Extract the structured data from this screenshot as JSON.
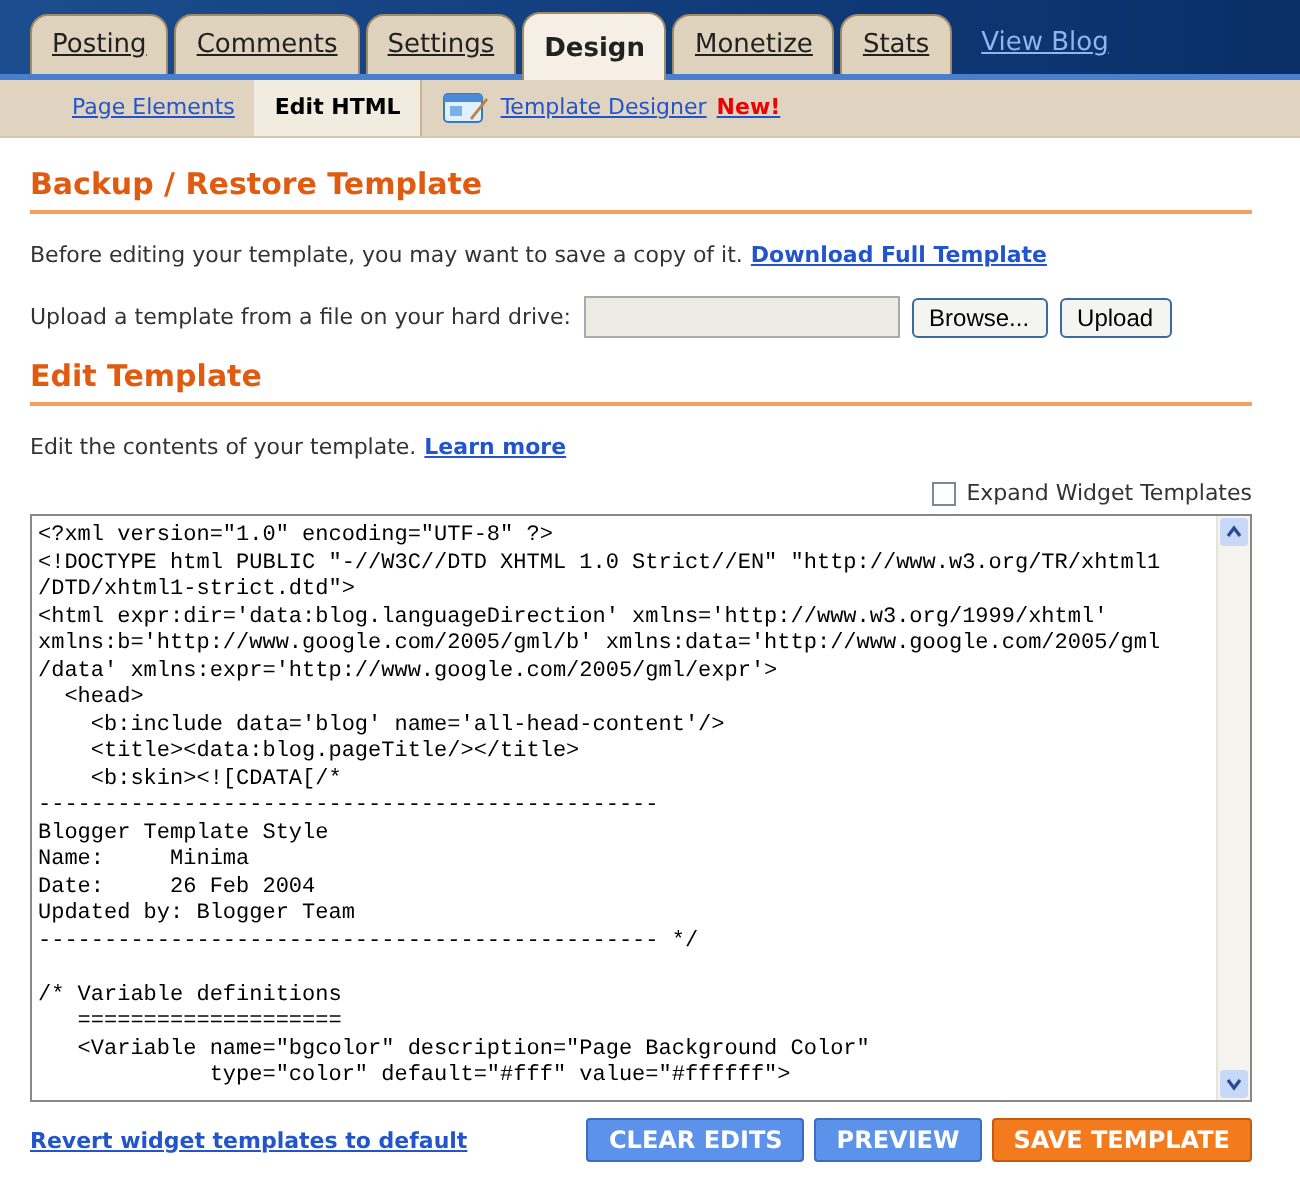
{
  "tabs": [
    {
      "label": "Posting",
      "selected": false
    },
    {
      "label": "Comments",
      "selected": false
    },
    {
      "label": "Settings",
      "selected": false
    },
    {
      "label": "Design",
      "selected": true
    },
    {
      "label": "Monetize",
      "selected": false
    },
    {
      "label": "Stats",
      "selected": false
    }
  ],
  "view_blog_link": "View Blog",
  "subnav": [
    {
      "label": "Page Elements",
      "selected": false
    },
    {
      "label": "Edit HTML",
      "selected": true
    },
    {
      "label": "Template Designer",
      "selected": false,
      "badge": "New!"
    }
  ],
  "backup": {
    "heading": "Backup / Restore Template",
    "intro": "Before editing your template, you may want to save a copy of it.",
    "download_link": "Download Full Template",
    "upload_label": "Upload a template from a file on your hard drive:",
    "browse_button": "Browse...",
    "upload_button": "Upload"
  },
  "edit": {
    "heading": "Edit Template",
    "intro": "Edit the contents of your template.",
    "learn_link": "Learn more",
    "expand_label": "Expand Widget Templates",
    "expand_checked": false,
    "code": "<?xml version=\"1.0\" encoding=\"UTF-8\" ?>\n<!DOCTYPE html PUBLIC \"-//W3C//DTD XHTML 1.0 Strict//EN\" \"http://www.w3.org/TR/xhtml1\n/DTD/xhtml1-strict.dtd\">\n<html expr:dir='data:blog.languageDirection' xmlns='http://www.w3.org/1999/xhtml'\nxmlns:b='http://www.google.com/2005/gml/b' xmlns:data='http://www.google.com/2005/gml\n/data' xmlns:expr='http://www.google.com/2005/gml/expr'>\n  <head>\n    <b:include data='blog' name='all-head-content'/>\n    <title><data:blog.pageTitle/></title>\n    <b:skin><![CDATA[/*\n-----------------------------------------------\nBlogger Template Style\nName:     Minima\nDate:     26 Feb 2004\nUpdated by: Blogger Team\n----------------------------------------------- */\n\n/* Variable definitions\n   ====================\n   <Variable name=\"bgcolor\" description=\"Page Background Color\"\n             type=\"color\" default=\"#fff\" value=\"#ffffff\">",
    "revert_link": "Revert widget templates to default",
    "buttons": [
      {
        "label": "CLEAR EDITS",
        "kind": "secondary"
      },
      {
        "label": "PREVIEW",
        "kind": "secondary"
      },
      {
        "label": "SAVE TEMPLATE",
        "kind": "primary"
      }
    ]
  }
}
